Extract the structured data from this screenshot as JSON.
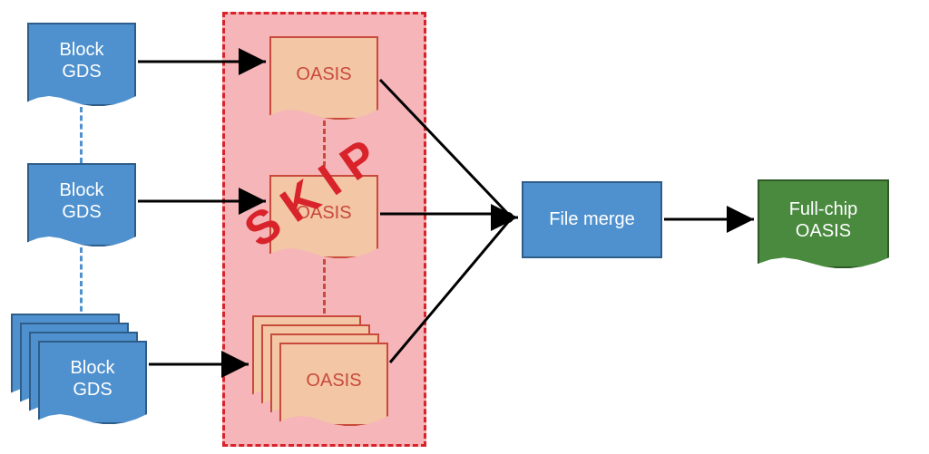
{
  "diagram": {
    "inputs": [
      {
        "label_line1": "Block",
        "label_line2": "GDS"
      },
      {
        "label_line1": "Block",
        "label_line2": "GDS"
      },
      {
        "label_line1": "Block",
        "label_line2": "GDS"
      }
    ],
    "intermediate": [
      {
        "label": "OASIS"
      },
      {
        "label": "OASIS"
      },
      {
        "label": "OASIS"
      }
    ],
    "skip_label": "SKIP",
    "merge_label": "File merge",
    "output": {
      "label_line1": "Full-chip",
      "label_line2": "OASIS"
    },
    "colors": {
      "blue": "#4f91ce",
      "blue_border": "#2e5d8a",
      "peach": "#f3c6a5",
      "peach_border": "#c94a3b",
      "red": "#d8232a",
      "pink": "#f5b5b9",
      "green": "#4a8a3f"
    }
  }
}
